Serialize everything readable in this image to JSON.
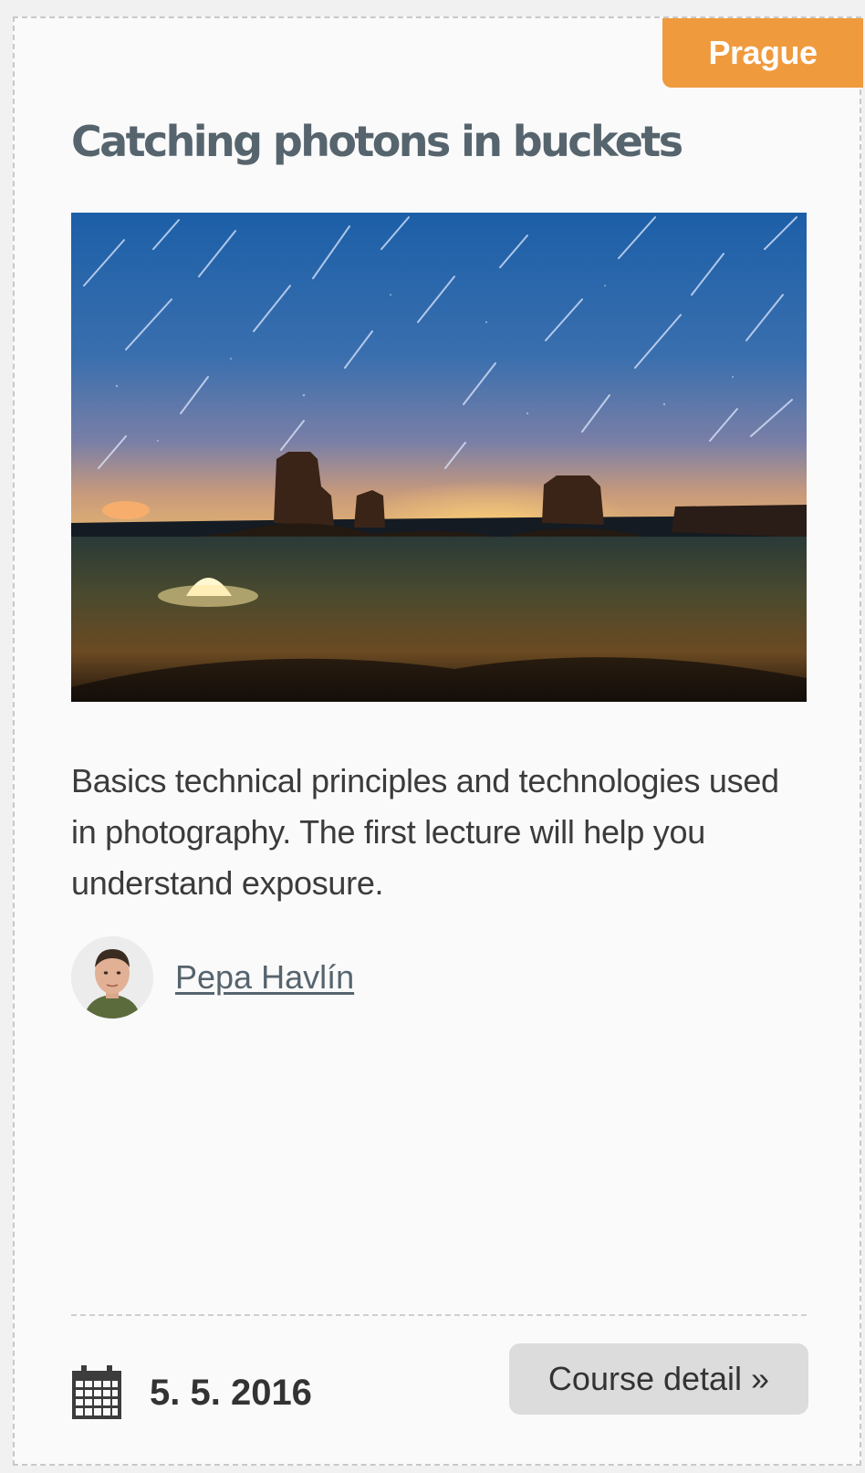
{
  "course": {
    "city_badge": "Prague",
    "title": "Catching photons in buckets",
    "description": "Basics technical principles and technologies used in photography. The first lecture will help you understand exposure.",
    "lecturer": "Pepa Havlín",
    "date": "5. 5. 2016",
    "detail_button": "Course detail »"
  },
  "icons": {
    "calendar": "calendar-icon"
  },
  "colors": {
    "badge": "#f09a3e",
    "title": "#56646e",
    "button_bg": "#dcdcdc",
    "card_bg": "#fafafa"
  }
}
